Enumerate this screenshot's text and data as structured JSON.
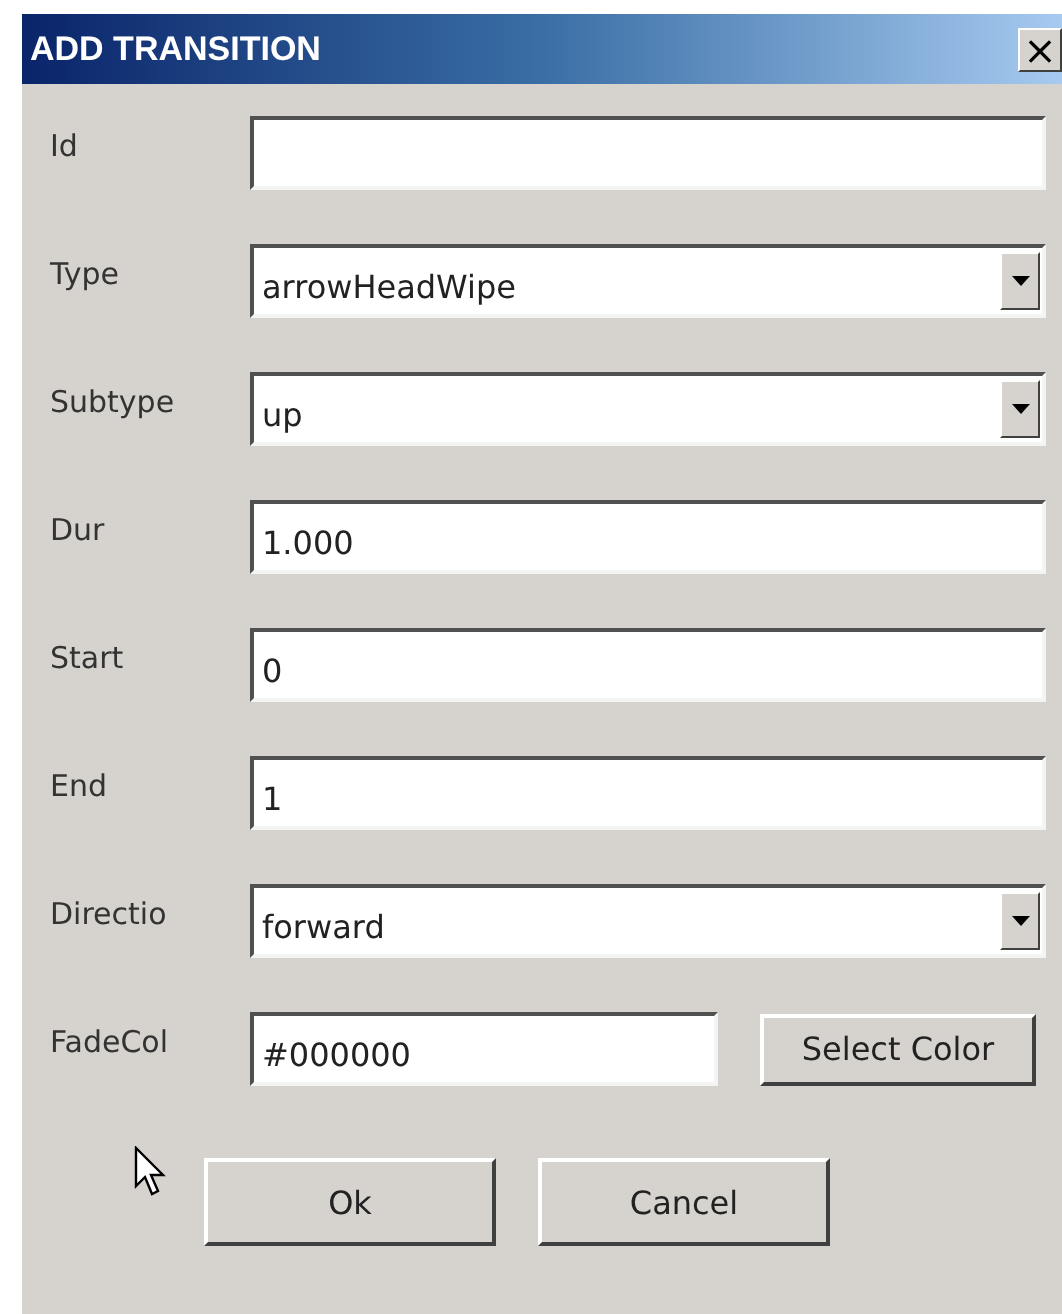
{
  "window": {
    "title": "ADD TRANSITION",
    "close": "×"
  },
  "fields": [
    {
      "kind": "text",
      "label": "Id"
    },
    {
      "kind": "select",
      "label": "Type",
      "value": "arrowHeadWipe"
    },
    {
      "kind": "select",
      "label": "Subtype",
      "value": "up"
    },
    {
      "kind": "text",
      "label": "Dur",
      "value": "1.000"
    },
    {
      "kind": "text",
      "label": "Start",
      "value": "0"
    },
    {
      "kind": "text",
      "label": "End",
      "value": "1"
    },
    {
      "kind": "select",
      "label": "Directio",
      "value": "forward"
    },
    {
      "kind": "color",
      "label": "FadeCol",
      "value": "#000000",
      "button": "Select Color"
    }
  ],
  "buttons": [
    "Ok",
    "Cancel"
  ]
}
